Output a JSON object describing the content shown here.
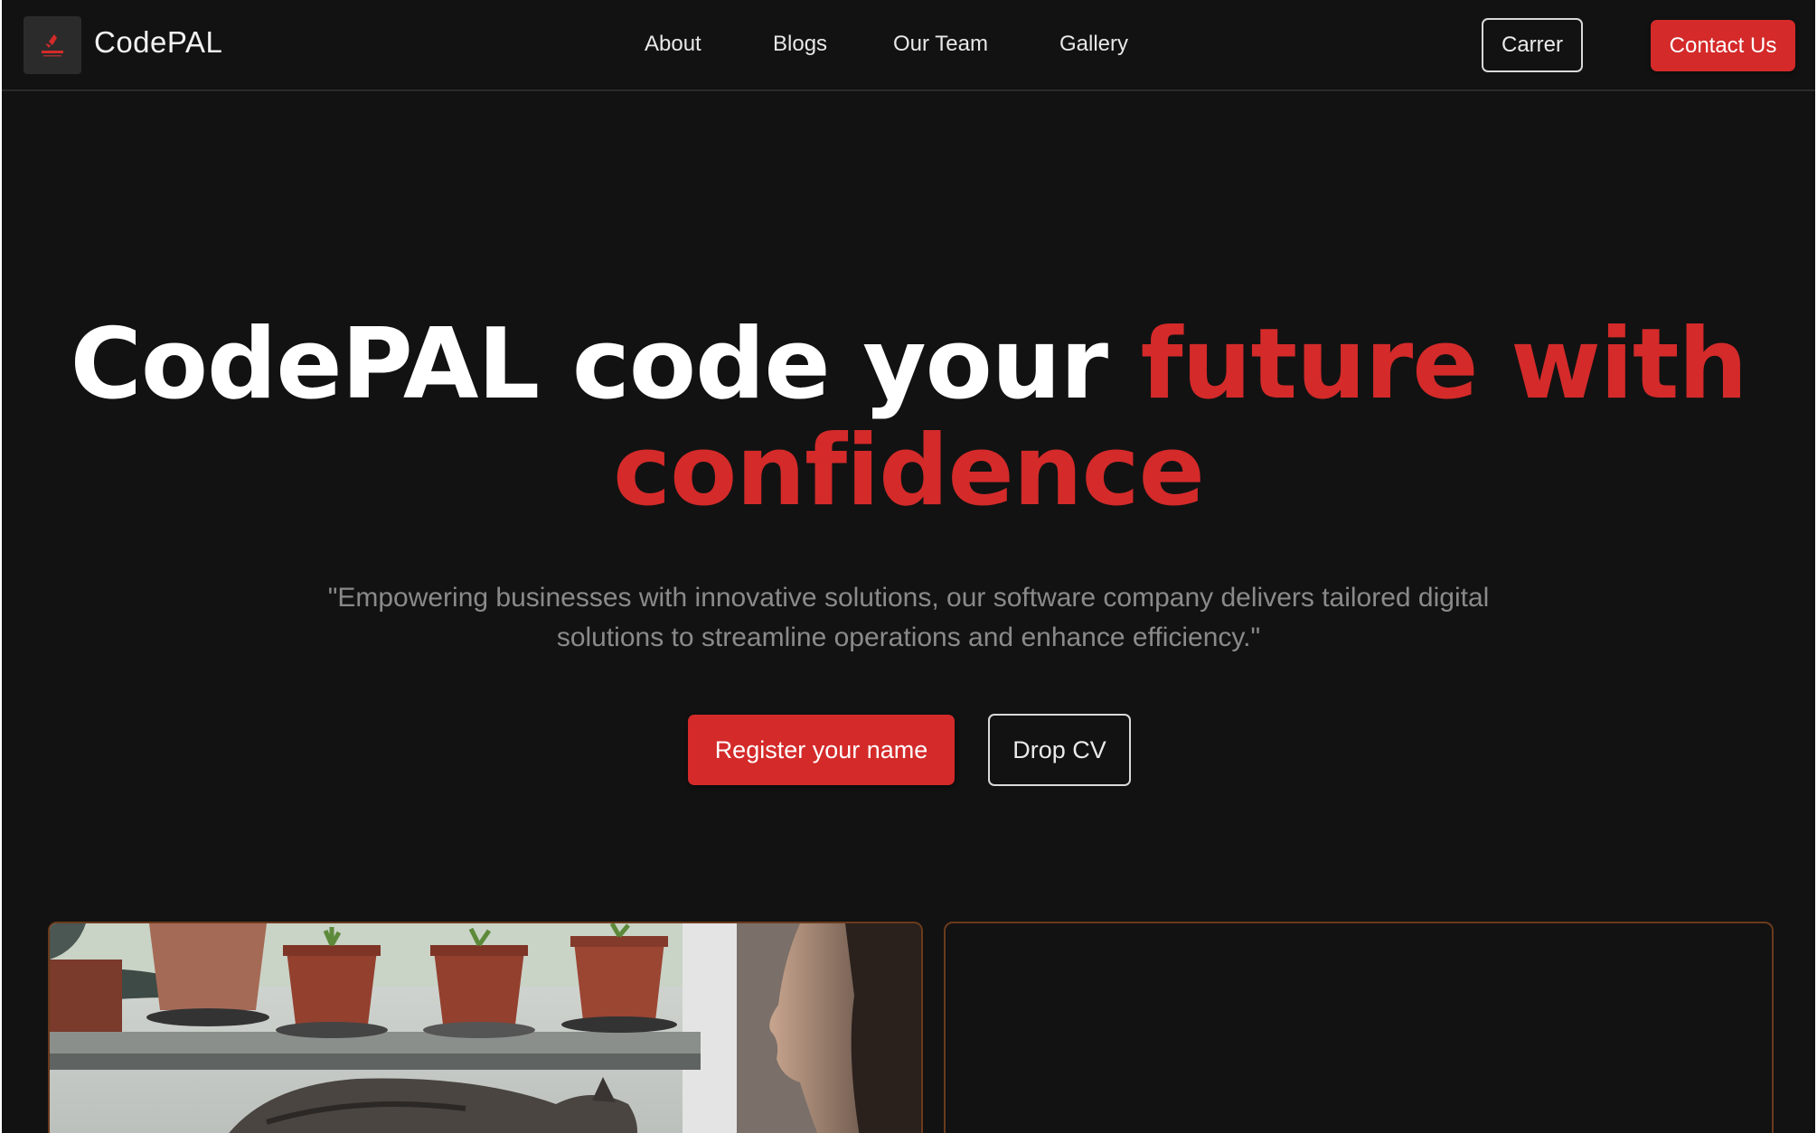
{
  "nav": {
    "brand": "CodePAL",
    "links": [
      "About",
      "Blogs",
      "Our Team",
      "Gallery"
    ],
    "career_label": "Carrer",
    "contact_label": "Contact Us"
  },
  "hero": {
    "title_white": "CodePAL code your ",
    "title_red_1": "future with",
    "title_red_2": "confidence",
    "subtitle_line1": "\"Empowering businesses with innovative solutions, our software company delivers tailored digital",
    "subtitle_line2": "solutions to streamline operations and enhance efficiency.\"",
    "register_label": "Register your name",
    "cv_label": "Drop CV"
  },
  "colors": {
    "background": "#121212",
    "accent_red": "#d42a2a",
    "card_border": "#6b3a1c",
    "subtitle_gray": "#8a8a8a"
  },
  "icons": {
    "logo": "codepal-logo-icon"
  }
}
